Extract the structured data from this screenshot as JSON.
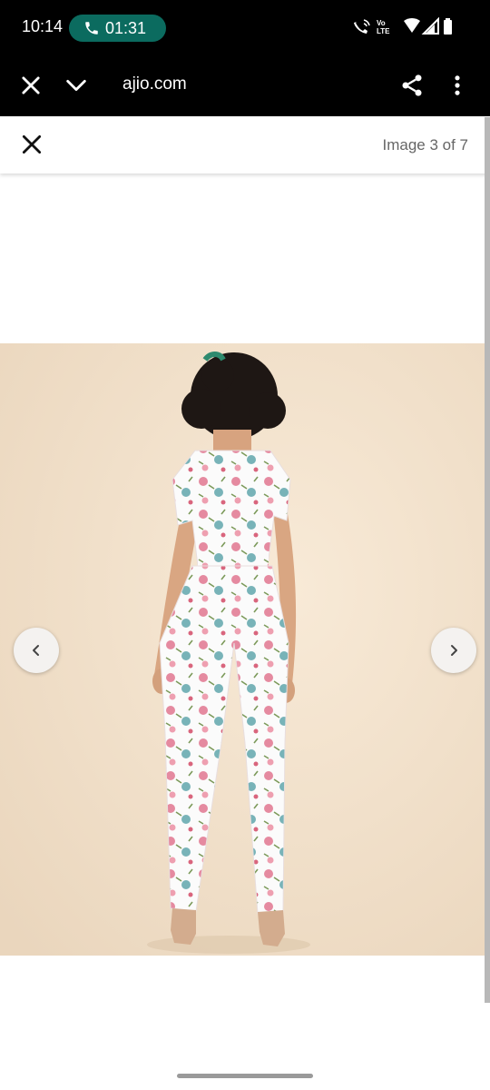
{
  "status_bar": {
    "time": "10:14",
    "call_duration": "01:31"
  },
  "browser": {
    "url": "ajio.com",
    "icons": [
      "close-icon",
      "chevron-down-icon",
      "share-icon",
      "more-vert-icon"
    ]
  },
  "gallery": {
    "counter": "Image 3 of 7",
    "image_alt": "Woman wearing white floral print crop top and trousers, back view",
    "colors": {
      "background": "#f3e5d1",
      "outfit": "#ffffff",
      "print_pink": "#e27d94",
      "print_teal": "#5fa6ad"
    }
  }
}
